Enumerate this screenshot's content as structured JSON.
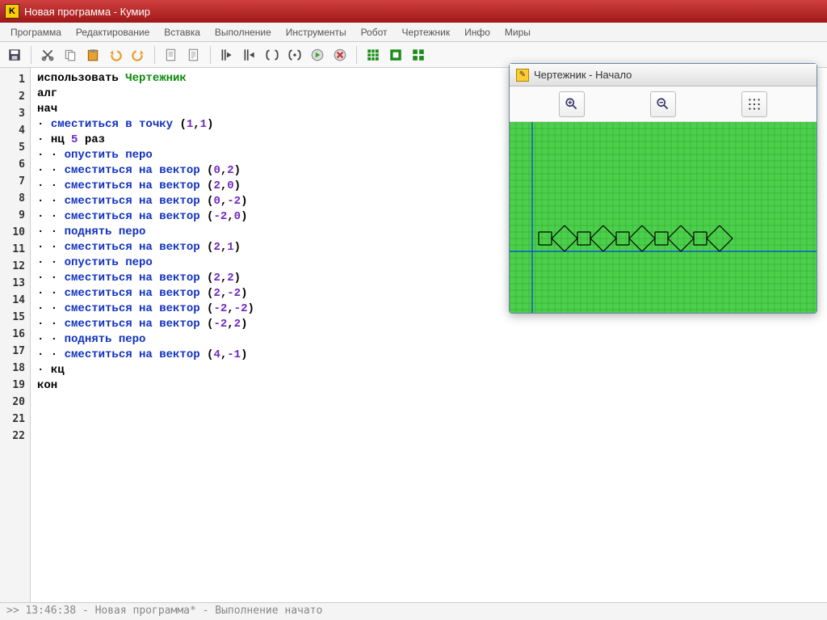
{
  "window": {
    "title": "Новая программа - Кумир"
  },
  "menu": {
    "items": [
      "Программа",
      "Редактирование",
      "Вставка",
      "Выполнение",
      "Инструменты",
      "Робот",
      "Чертежник",
      "Инфо",
      "Миры"
    ]
  },
  "statusbar": {
    "text": ">> 13:46:38 - Новая программа* - Выполнение начато"
  },
  "draw_window": {
    "title": "Чертежник - Начало"
  },
  "code": [
    {
      "n": 1,
      "ind": 0,
      "tokens": [
        {
          "t": "использовать ",
          "c": "kw-use"
        },
        {
          "t": "Чертежник",
          "c": "kw-mod"
        }
      ]
    },
    {
      "n": 2,
      "ind": 0,
      "tokens": [
        {
          "t": "алг",
          "c": "kw-black"
        }
      ]
    },
    {
      "n": 3,
      "ind": 0,
      "tokens": [
        {
          "t": "нач",
          "c": "kw-black"
        }
      ]
    },
    {
      "n": 4,
      "ind": 1,
      "tokens": [
        {
          "t": "сместиться в точку ",
          "c": "kw-blue"
        },
        {
          "t": "(",
          "c": "paren"
        },
        {
          "t": "1",
          "c": "num"
        },
        {
          "t": ",",
          "c": "paren"
        },
        {
          "t": "1",
          "c": "num"
        },
        {
          "t": ")",
          "c": "paren"
        }
      ]
    },
    {
      "n": 5,
      "ind": 1,
      "tokens": [
        {
          "t": "нц ",
          "c": "kw-black"
        },
        {
          "t": "5",
          "c": "num"
        },
        {
          "t": " раз",
          "c": "kw-black"
        }
      ]
    },
    {
      "n": 6,
      "ind": 2,
      "tokens": [
        {
          "t": "опустить перо",
          "c": "kw-blue"
        }
      ]
    },
    {
      "n": 7,
      "ind": 2,
      "tokens": [
        {
          "t": "сместиться на вектор ",
          "c": "kw-blue"
        },
        {
          "t": "(",
          "c": "paren"
        },
        {
          "t": "0",
          "c": "num"
        },
        {
          "t": ",",
          "c": "paren"
        },
        {
          "t": "2",
          "c": "num"
        },
        {
          "t": ")",
          "c": "paren"
        }
      ]
    },
    {
      "n": 8,
      "ind": 2,
      "tokens": [
        {
          "t": "сместиться на вектор ",
          "c": "kw-blue"
        },
        {
          "t": "(",
          "c": "paren"
        },
        {
          "t": "2",
          "c": "num"
        },
        {
          "t": ",",
          "c": "paren"
        },
        {
          "t": "0",
          "c": "num"
        },
        {
          "t": ")",
          "c": "paren"
        }
      ]
    },
    {
      "n": 9,
      "ind": 2,
      "tokens": [
        {
          "t": "сместиться на вектор ",
          "c": "kw-blue"
        },
        {
          "t": "(",
          "c": "paren"
        },
        {
          "t": "0",
          "c": "num"
        },
        {
          "t": ",",
          "c": "paren"
        },
        {
          "t": "-2",
          "c": "num"
        },
        {
          "t": ")",
          "c": "paren"
        }
      ]
    },
    {
      "n": 10,
      "ind": 2,
      "tokens": [
        {
          "t": "сместиться на вектор ",
          "c": "kw-blue"
        },
        {
          "t": "(",
          "c": "paren"
        },
        {
          "t": "-2",
          "c": "num"
        },
        {
          "t": ",",
          "c": "paren"
        },
        {
          "t": "0",
          "c": "num"
        },
        {
          "t": ")",
          "c": "paren"
        }
      ]
    },
    {
      "n": 11,
      "ind": 2,
      "tokens": [
        {
          "t": "поднять перо",
          "c": "kw-blue"
        }
      ]
    },
    {
      "n": 12,
      "ind": 2,
      "tokens": [
        {
          "t": "сместиться на вектор ",
          "c": "kw-blue"
        },
        {
          "t": "(",
          "c": "paren"
        },
        {
          "t": "2",
          "c": "num"
        },
        {
          "t": ",",
          "c": "paren"
        },
        {
          "t": "1",
          "c": "num"
        },
        {
          "t": ")",
          "c": "paren"
        }
      ]
    },
    {
      "n": 13,
      "ind": 2,
      "tokens": [
        {
          "t": "опустить перо",
          "c": "kw-blue"
        }
      ]
    },
    {
      "n": 14,
      "ind": 2,
      "tokens": [
        {
          "t": "сместиться на вектор ",
          "c": "kw-blue"
        },
        {
          "t": "(",
          "c": "paren"
        },
        {
          "t": "2",
          "c": "num"
        },
        {
          "t": ",",
          "c": "paren"
        },
        {
          "t": "2",
          "c": "num"
        },
        {
          "t": ")",
          "c": "paren"
        }
      ]
    },
    {
      "n": 15,
      "ind": 2,
      "tokens": [
        {
          "t": "сместиться на вектор ",
          "c": "kw-blue"
        },
        {
          "t": "(",
          "c": "paren"
        },
        {
          "t": "2",
          "c": "num"
        },
        {
          "t": ",",
          "c": "paren"
        },
        {
          "t": "-2",
          "c": "num"
        },
        {
          "t": ")",
          "c": "paren"
        }
      ]
    },
    {
      "n": 16,
      "ind": 2,
      "tokens": [
        {
          "t": "сместиться на вектор ",
          "c": "kw-blue"
        },
        {
          "t": "(",
          "c": "paren"
        },
        {
          "t": "-2",
          "c": "num"
        },
        {
          "t": ",",
          "c": "paren"
        },
        {
          "t": "-2",
          "c": "num"
        },
        {
          "t": ")",
          "c": "paren"
        }
      ]
    },
    {
      "n": 17,
      "ind": 2,
      "tokens": [
        {
          "t": "сместиться на вектор ",
          "c": "kw-blue"
        },
        {
          "t": "(",
          "c": "paren"
        },
        {
          "t": "-2",
          "c": "num"
        },
        {
          "t": ",",
          "c": "paren"
        },
        {
          "t": "2",
          "c": "num"
        },
        {
          "t": ")",
          "c": "paren"
        }
      ]
    },
    {
      "n": 18,
      "ind": 2,
      "tokens": [
        {
          "t": "поднять перо",
          "c": "kw-blue"
        }
      ]
    },
    {
      "n": 19,
      "ind": 2,
      "tokens": [
        {
          "t": "сместиться на вектор ",
          "c": "kw-blue"
        },
        {
          "t": "(",
          "c": "paren"
        },
        {
          "t": "4",
          "c": "num"
        },
        {
          "t": ",",
          "c": "paren"
        },
        {
          "t": "-1",
          "c": "num"
        },
        {
          "t": ")",
          "c": "paren"
        }
      ]
    },
    {
      "n": 20,
      "ind": 1,
      "tokens": [
        {
          "t": "кц",
          "c": "kw-black"
        }
      ]
    },
    {
      "n": 21,
      "ind": 0,
      "tokens": [
        {
          "t": "кон",
          "c": "kw-black"
        }
      ]
    },
    {
      "n": 22,
      "ind": 0,
      "tokens": [
        {
          "t": "",
          "c": "kw-black"
        }
      ]
    }
  ]
}
